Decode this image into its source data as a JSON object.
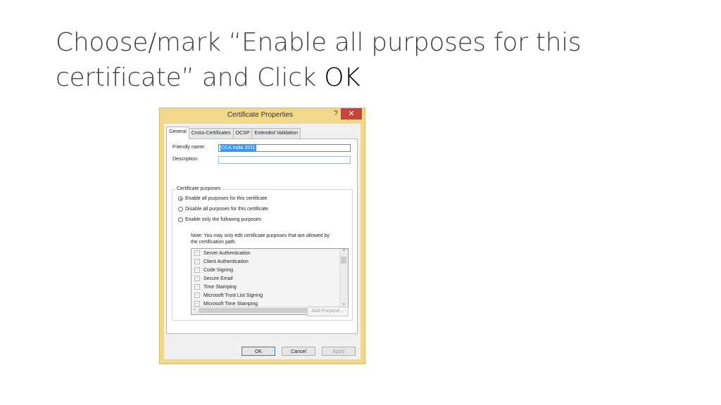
{
  "slide": {
    "title_main": "Choose/mark “Enable all purposes for this certificate” and Click ",
    "title_emphasis": "OK"
  },
  "dialog": {
    "title": "Certificate Properties",
    "help_glyph": "?",
    "close_glyph": "✕",
    "tabs": [
      "General",
      "Cross-Certificates",
      "OCSP",
      "Extended Validation"
    ],
    "active_tab": "General",
    "friendly_name_label": "Friendly name:",
    "friendly_name_value": "CCA India 2011",
    "description_label": "Description:",
    "description_value": "",
    "purposes_group_label": "Certificate purposes",
    "radio_options": [
      "Enable all purposes for this certificate",
      "Disable all purposes for this certificate",
      "Enable only the following purposes"
    ],
    "selected_option": "Enable all purposes for this certificate",
    "note_line1": "Note: You may only edit certificate purposes that are allowed by",
    "note_line2": "the certification path.",
    "purposes": [
      "Server Authentication",
      "Client Authentication",
      "Code Signing",
      "Secure Email",
      "Time Stamping",
      "Microsoft Trust List Signing",
      "Microsoft Time Stamping"
    ],
    "check_glyph": "✓",
    "scroll_up_glyph": "˄",
    "scroll_down_glyph": "˅",
    "scroll_left_glyph": "‹",
    "scroll_right_glyph": "›",
    "add_purpose_label": "Add Purpose...",
    "ok_label": "OK",
    "cancel_label": "Cancel",
    "apply_label": "Apply"
  }
}
